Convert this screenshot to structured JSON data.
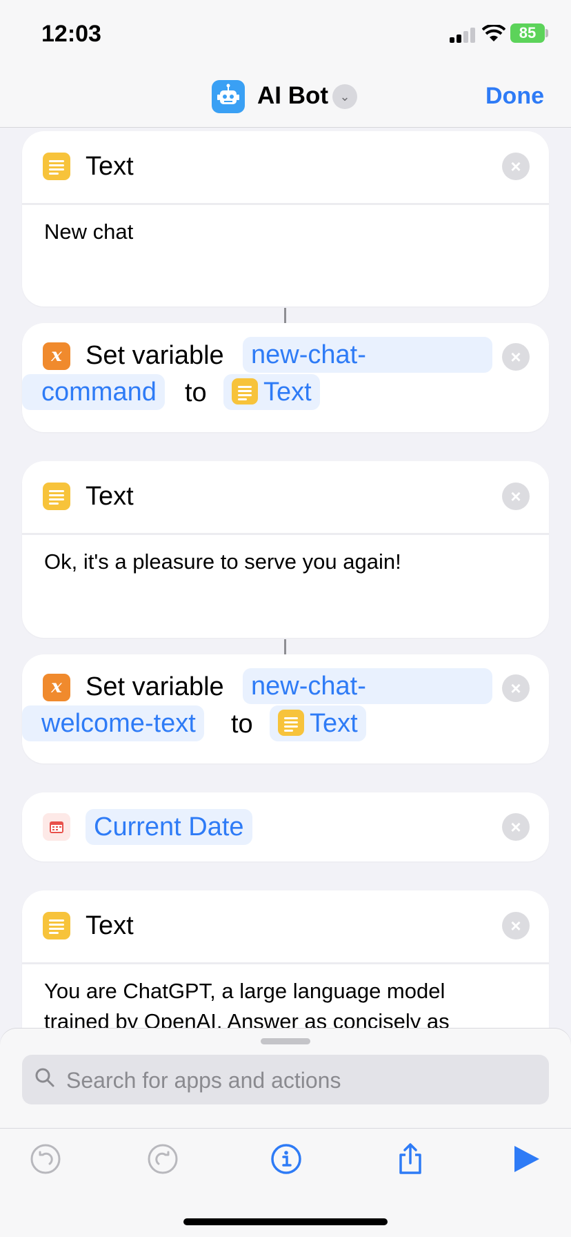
{
  "status_bar": {
    "time": "12:03",
    "battery": "85"
  },
  "nav": {
    "title": "AI Bot",
    "done_label": "Done"
  },
  "cards": {
    "text1": {
      "label": "Text",
      "content": "New chat"
    },
    "setvar1": {
      "action": "Set variable",
      "var_line1": "new-chat-",
      "var_line2": "command",
      "to_label": "to",
      "value": "Text"
    },
    "text2": {
      "label": "Text",
      "content": "Ok, it's a pleasure to serve you again!"
    },
    "setvar2": {
      "action": "Set variable",
      "var_line1": "new-chat-",
      "var_line2": "welcome-text",
      "to_label": "to",
      "value": "Text"
    },
    "date": {
      "label": "Current Date"
    },
    "text3": {
      "label": "Text",
      "line1": "You are ChatGPT, a large language model",
      "line2": "trained by OpenAI. Answer as concisely as"
    }
  },
  "search": {
    "placeholder": "Search for apps and actions"
  },
  "colors": {
    "accent": "#2e7bf6",
    "text_icon": "#f7c33b",
    "variable_icon": "#f08a2d",
    "battery": "#5cd35a"
  },
  "icons": [
    "robot-icon",
    "chevron-down-icon",
    "text-icon",
    "variable-icon",
    "calendar-icon",
    "close-icon",
    "search-icon",
    "undo-icon",
    "redo-icon",
    "info-icon",
    "share-icon",
    "play-icon"
  ]
}
